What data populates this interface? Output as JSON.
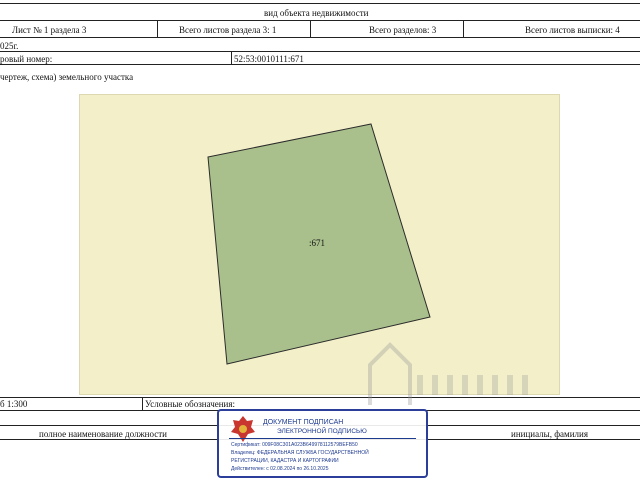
{
  "header": {
    "section_title": "вид объекта недвижимости",
    "sheet_no": "Лист № 1 раздела 3",
    "total_sheets_section": "Всего листов раздела 3: 1",
    "total_sections": "Всего разделов: 3",
    "total_sheets_extract": "Всего листов выписки: 4",
    "date_fragment": "025г.",
    "cadastral_label": "ровый номер:",
    "cadastral_number": "52:53:0010111:671",
    "plan_label": "чертеж, схема) земельного участка"
  },
  "map": {
    "parcel_label": ":671",
    "fill_color": "#a9c08c",
    "background_color": "#f3f0c9"
  },
  "footer": {
    "scale": "б 1:300",
    "legend_label": "Условные обозначения:",
    "position_label": "полное наименование должности",
    "initials_label": "инициалы, фамилия"
  },
  "stamp": {
    "title": "ДОКУМЕНТ ПОДПИСАН",
    "subtitle": "ЭЛЕКТРОННОЙ ПОДПИСЬЮ",
    "certificate": "Сертификат: 009F08C301A023B649978112579BEFB50",
    "owner_line1": "Владелец: ФЕДЕРАЛЬНАЯ СЛУЖБА ГОСУДАРСТВЕННОЙ",
    "owner_line2": "РЕГИСТРАЦИИ, КАДАСТРА И КАРТОГРАФИИ",
    "valid": "Действителен: с 02.08.2024 по 26.10.2025",
    "color": "#2b3f9a"
  }
}
